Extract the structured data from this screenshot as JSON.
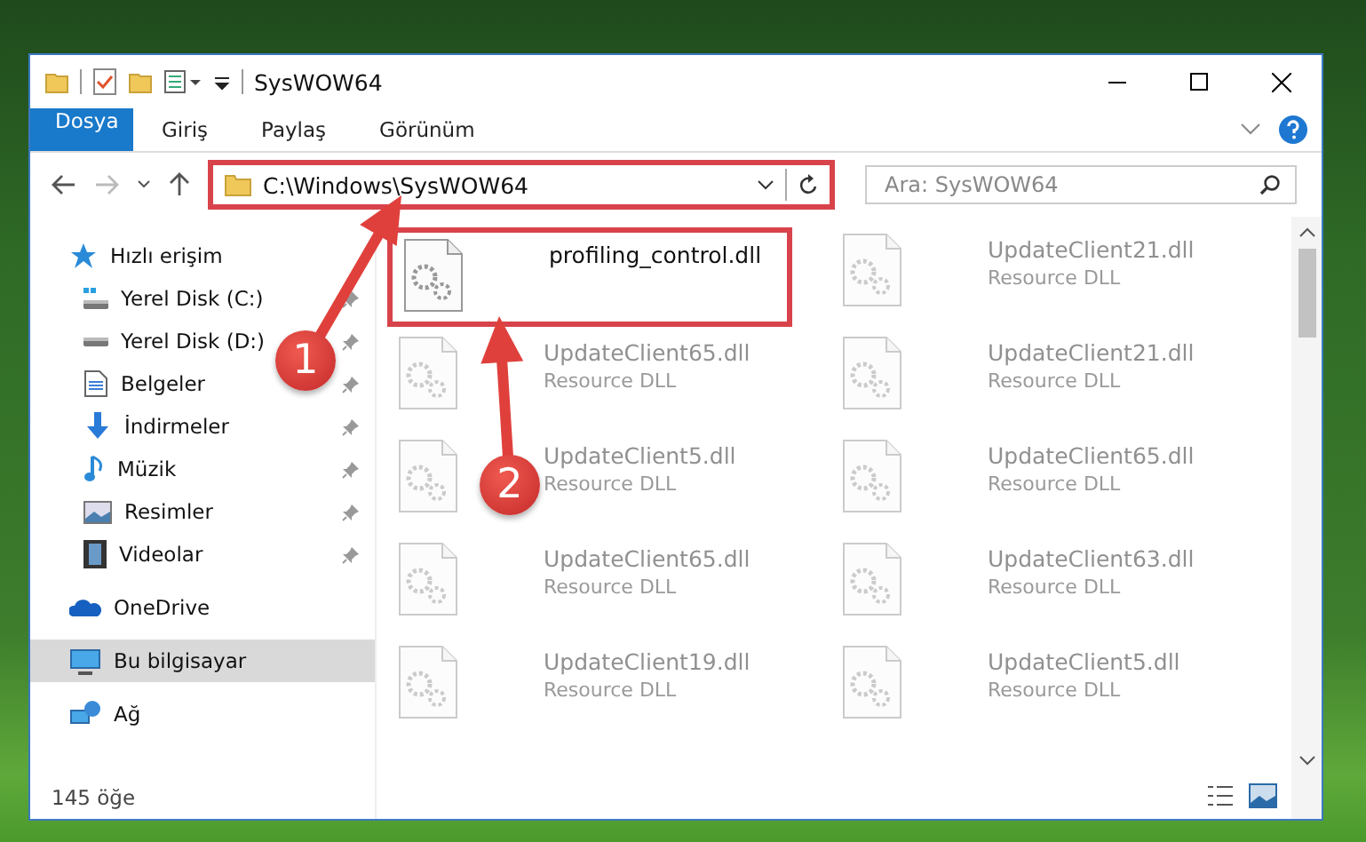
{
  "window": {
    "title": "SysWOW64"
  },
  "ribbon": {
    "tabs": [
      {
        "label": "Dosya",
        "kind": "file"
      },
      {
        "label": "Giriş",
        "kind": "tab"
      },
      {
        "label": "Paylaş",
        "kind": "tab"
      },
      {
        "label": "Görünüm",
        "kind": "tab"
      }
    ]
  },
  "address_bar": {
    "path": "C:\\Windows\\SysWOW64",
    "highlighted": true
  },
  "search": {
    "placeholder": "Ara: SysWOW64"
  },
  "sidebar": {
    "items": [
      {
        "label": "Hızlı erişim",
        "kind": "star",
        "selected": false,
        "children": [
          {
            "label": "Yerel Disk (C:)",
            "kind": "system-drive",
            "selected": false,
            "pinned": true
          },
          {
            "label": "Yerel Disk (D:)",
            "kind": "drive",
            "selected": false,
            "pinned": true
          },
          {
            "label": "Belgeler",
            "kind": "documents",
            "selected": false,
            "pinned": true
          },
          {
            "label": "İndirmeler",
            "kind": "downloads",
            "selected": false,
            "pinned": true
          },
          {
            "label": "Müzik",
            "kind": "music",
            "selected": false,
            "pinned": true
          },
          {
            "label": "Resimler",
            "kind": "pictures",
            "selected": false,
            "pinned": true
          },
          {
            "label": "Videolar",
            "kind": "videos",
            "selected": false,
            "pinned": true
          }
        ]
      },
      {
        "label": "OneDrive",
        "kind": "cloud",
        "selected": false
      },
      {
        "label": "Bu bilgisayar",
        "kind": "computer",
        "selected": true
      },
      {
        "label": "Ağ",
        "kind": "network",
        "selected": false
      }
    ]
  },
  "files": [
    {
      "name": "profiling_control.dll",
      "highlighted": true,
      "faded": false
    },
    {
      "name": "UpdateClient21.dll",
      "type": "Resource DLL",
      "highlighted": false,
      "faded": true
    },
    {
      "name": "UpdateClient65.dll",
      "type": "Resource DLL",
      "highlighted": false,
      "faded": true
    },
    {
      "name": "UpdateClient21.dll",
      "type": "Resource DLL",
      "highlighted": false,
      "faded": true
    },
    {
      "name": "UpdateClient5.dll",
      "type": "Resource DLL",
      "highlighted": false,
      "faded": true
    },
    {
      "name": "UpdateClient65.dll",
      "type": "Resource DLL",
      "highlighted": false,
      "faded": true
    },
    {
      "name": "UpdateClient65.dll",
      "type": "Resource DLL",
      "highlighted": false,
      "faded": true
    },
    {
      "name": "UpdateClient63.dll",
      "type": "Resource DLL",
      "highlighted": false,
      "faded": true
    },
    {
      "name": "UpdateClient19.dll",
      "type": "Resource DLL",
      "highlighted": false,
      "faded": true
    },
    {
      "name": "UpdateClient5.dll",
      "type": "Resource DLL",
      "highlighted": false,
      "faded": true
    }
  ],
  "status_bar": {
    "count": "145 öğe"
  },
  "annotations": [
    {
      "label": "1"
    },
    {
      "label": "2"
    }
  ]
}
